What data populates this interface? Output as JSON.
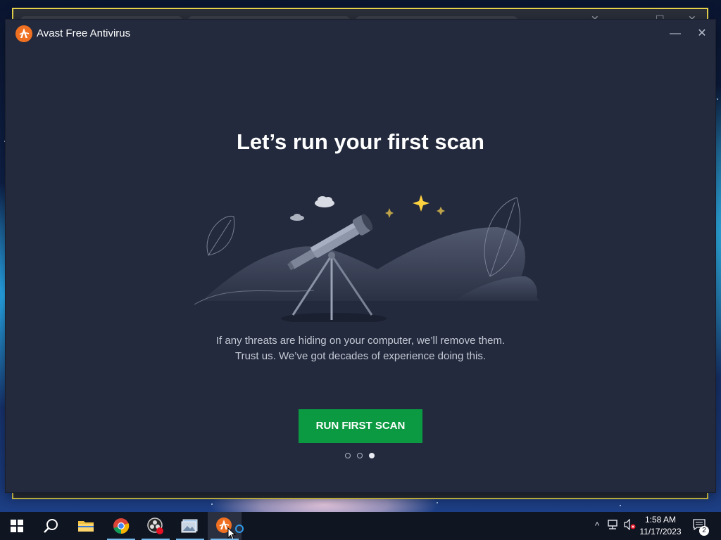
{
  "app": {
    "title": "Avast Free Antivirus",
    "minimize_icon": "minimize-icon",
    "close_icon": "close-icon"
  },
  "onboarding": {
    "headline": "Let’s run your first scan",
    "description_line1": "If any threats are hiding on your computer, we’ll remove them.",
    "description_line2": "Trust us. We’ve got decades of experience doing this.",
    "cta_label": "RUN FIRST SCAN",
    "pager": {
      "total": 3,
      "active_index": 2
    }
  },
  "colors": {
    "window_bg": "#232a3d",
    "cta_bg": "#0b9a41",
    "brand_orange": "#f07021"
  },
  "taskbar": {
    "items": [
      {
        "name": "start",
        "icon": "windows-icon"
      },
      {
        "name": "search",
        "icon": "search-icon"
      },
      {
        "name": "file-explorer",
        "icon": "folder-icon"
      },
      {
        "name": "chrome",
        "icon": "chrome-icon"
      },
      {
        "name": "obs",
        "icon": "record-icon"
      },
      {
        "name": "image-viewer",
        "icon": "image-icon"
      },
      {
        "name": "avast",
        "icon": "avast-icon"
      }
    ],
    "clock_time": "1:58 AM",
    "clock_date": "11/17/2023",
    "notification_count": "2"
  }
}
